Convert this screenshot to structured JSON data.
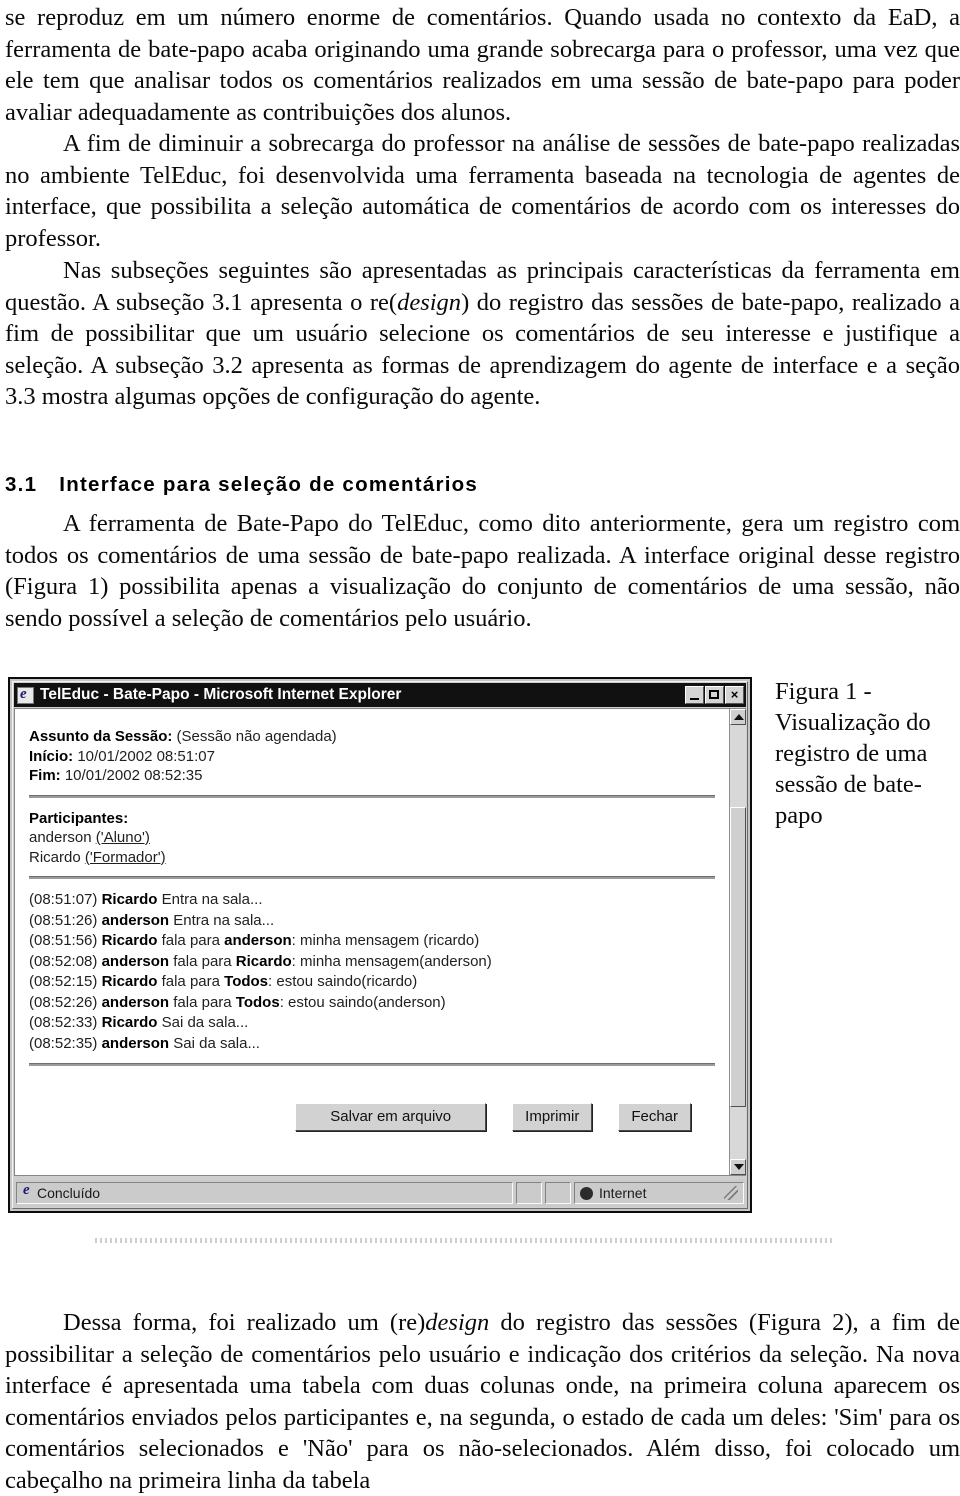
{
  "document": {
    "paragraphs": {
      "p1": "se reproduz em um número enorme de comentários. Quando usada no contexto da EaD, a ferramenta de bate-papo acaba originando uma grande sobrecarga para o professor, uma vez que ele tem que analisar todos os comentários  realizados em uma sessão de bate-papo para poder avaliar adequadamente as contribuições dos alunos.",
      "p2": "A fim de diminuir a sobrecarga do professor na análise de sessões de bate-papo realizadas no ambiente TelEduc, foi desenvolvida uma ferramenta baseada na tecnologia de agentes de interface, que possibilita a seleção automática de comentários de acordo com os interesses do professor.",
      "p3_part1": "Nas subseções seguintes são apresentadas as principais características da ferramenta em questão. A subseção 3.1 apresenta o re(",
      "p3_italic": "design",
      "p3_part2": ") do registro das sessões de bate-papo, realizado a fim de possibilitar que um usuário selecione os comentários de seu interesse e justifique a seleção. A subseção 3.2 apresenta as formas de aprendizagem do agente de interface e a seção 3.3 mostra algumas opções de configuração do agente.",
      "p4": "A ferramenta de Bate-Papo do TelEduc, como dito anteriormente, gera um registro com todos os comentários de uma sessão de bate-papo realizada. A interface original desse registro (Figura 1) possibilita apenas a visualização do conjunto de comentários de uma sessão, não sendo possível a seleção de comentários pelo usuário.",
      "p5_part1": "Dessa forma, foi realizado um (re)",
      "p5_italic": "design",
      "p5_part2": " do registro das sessões (Figura 2), a fim de possibilitar a seleção de comentários pelo usuário e indicação dos critérios da seleção. Na nova interface é apresentada uma tabela com duas colunas onde, na primeira coluna aparecem os comentários enviados pelos participantes e, na segunda, o estado de cada um deles: 'Sim' para os comentários selecionados e 'Não' para os não-selecionados. Além disso, foi colocado um cabeçalho na primeira linha da tabela"
    },
    "heading": {
      "number": "3.1",
      "title": "Interface para seleção de comentários"
    },
    "figure_caption": "Figura 1 - Visualização do registro de uma sessão de bate-papo"
  },
  "browser": {
    "titlebar": {
      "title": "TelEduc - Bate-Papo - Microsoft Internet Explorer",
      "icon": "ie-logo-icon",
      "minimize_label": "",
      "maximize_label": "",
      "close_label": "×"
    },
    "session": {
      "subject_label": "Assunto da Sessão:",
      "subject_value": "(Sessão não agendada)",
      "start_label": "Início:",
      "start_value": "10/01/2002 08:51:07",
      "end_label": "Fim:",
      "end_value": "10/01/2002 08:52:35",
      "participants_label": "Participantes:",
      "participants": [
        {
          "name": "anderson",
          "role": "('Aluno')"
        },
        {
          "name": "Ricardo",
          "role": "('Formador')"
        }
      ]
    },
    "chat_log": [
      {
        "time": "(08:51:07)",
        "speaker": "Ricardo",
        "action": "Entra na sala...",
        "target": "",
        "message": ""
      },
      {
        "time": "(08:51:26)",
        "speaker": "anderson",
        "action": "Entra na sala...",
        "target": "",
        "message": ""
      },
      {
        "time": "(08:51:56)",
        "speaker": "Ricardo",
        "action": "fala para",
        "target": "anderson",
        "message": ": minha mensagem (ricardo)"
      },
      {
        "time": "(08:52:08)",
        "speaker": "anderson",
        "action": "fala para",
        "target": "Ricardo",
        "message": ": minha mensagem(anderson)"
      },
      {
        "time": "(08:52:15)",
        "speaker": "Ricardo",
        "action": "fala para",
        "target": "Todos",
        "message": ": estou saindo(ricardo)"
      },
      {
        "time": "(08:52:26)",
        "speaker": "anderson",
        "action": "fala para",
        "target": "Todos",
        "message": ": estou saindo(anderson)"
      },
      {
        "time": "(08:52:33)",
        "speaker": "Ricardo",
        "action": "Sai da sala...",
        "target": "",
        "message": ""
      },
      {
        "time": "(08:52:35)",
        "speaker": "anderson",
        "action": "Sai da sala...",
        "target": "",
        "message": ""
      }
    ],
    "buttons": {
      "save": "Salvar em arquivo",
      "print": "Imprimir",
      "close": "Fechar"
    },
    "statusbar": {
      "status": "Concluído",
      "zone": "Internet"
    }
  }
}
